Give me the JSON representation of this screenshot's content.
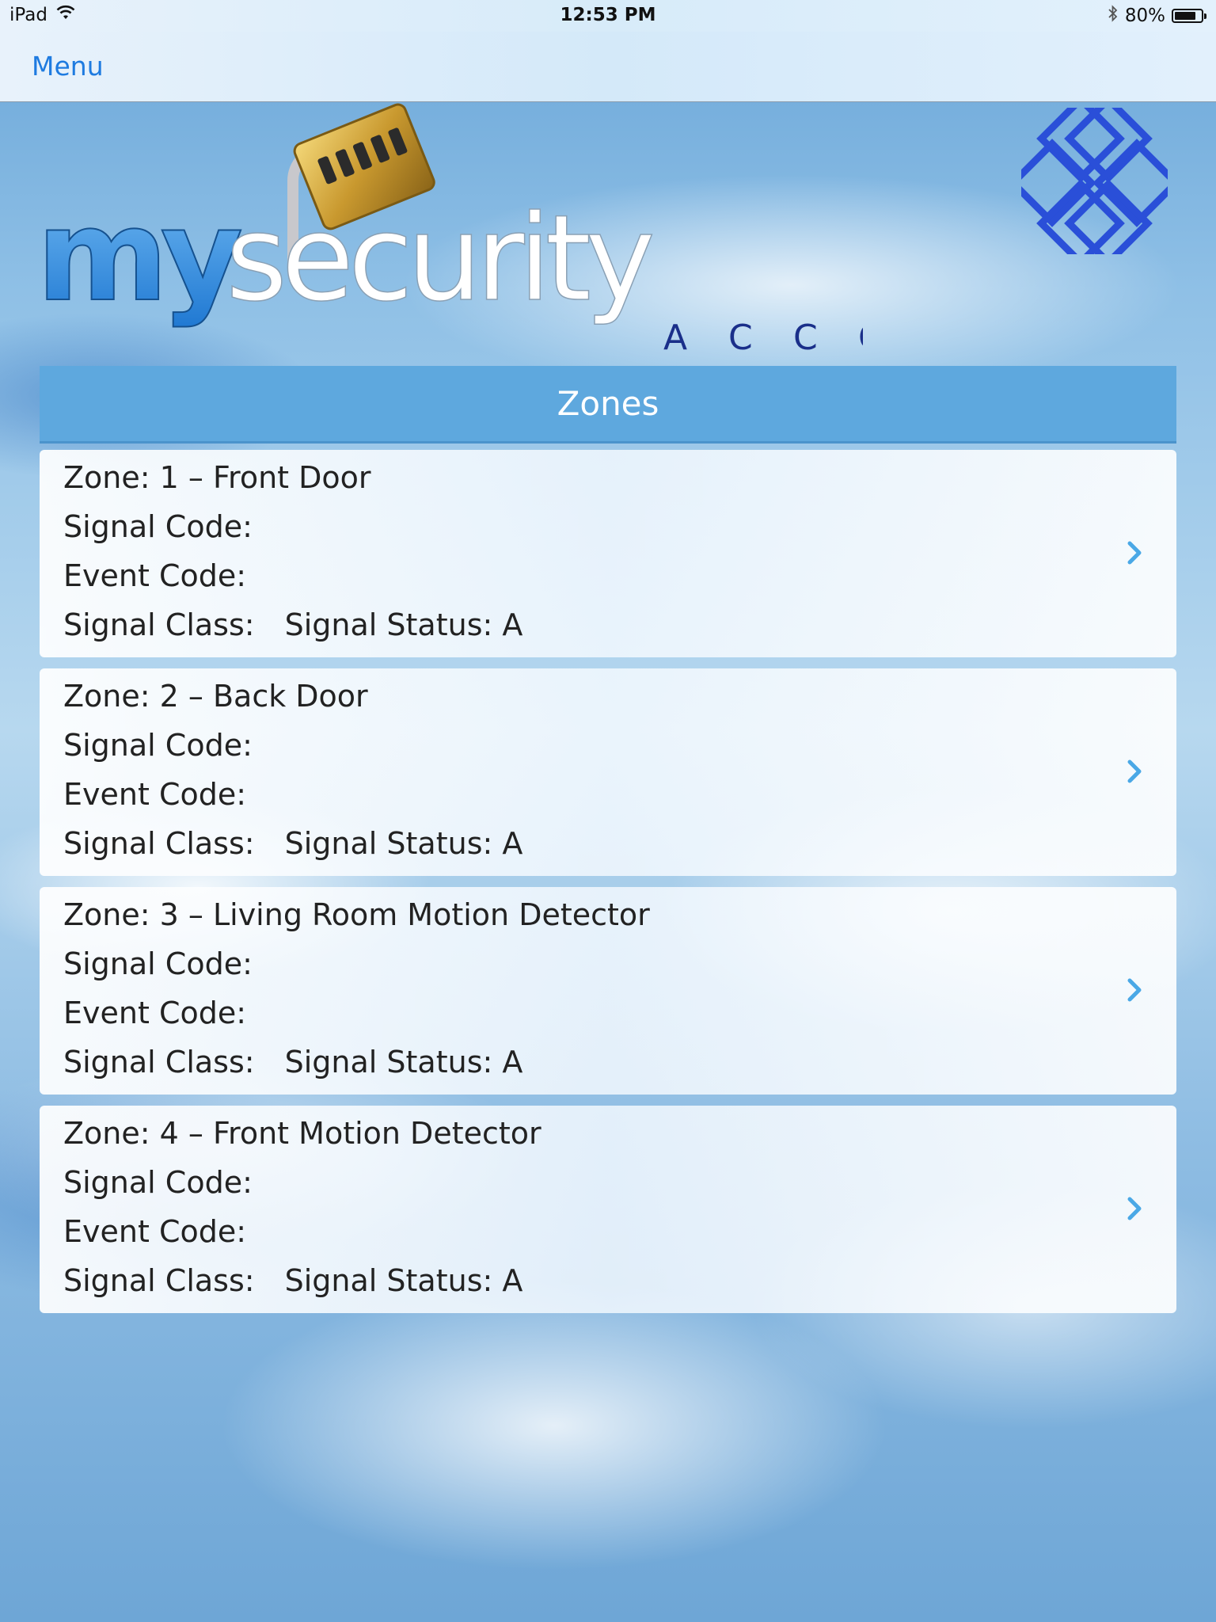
{
  "status_bar": {
    "device": "iPad",
    "time": "12:53 PM",
    "battery_text": "80%",
    "battery_level": 0.8,
    "icons": [
      "wifi-icon",
      "bluetooth-icon",
      "battery-icon"
    ]
  },
  "nav": {
    "menu_label": "Menu"
  },
  "logo": {
    "word_my": "my",
    "word_security": "security",
    "word_account": "A C C O U N T"
  },
  "zones": {
    "title": "Zones",
    "items": [
      {
        "zone": "Zone: 1 – Front Door",
        "signal_code": "Signal Code:",
        "event_code": "Event Code:",
        "signal_class": "Signal Class:",
        "signal_status": "Signal Status: A"
      },
      {
        "zone": "Zone: 2 – Back Door",
        "signal_code": "Signal Code:",
        "event_code": "Event Code:",
        "signal_class": "Signal Class:",
        "signal_status": "Signal Status: A"
      },
      {
        "zone": "Zone: 3 – Living Room Motion Detector",
        "signal_code": "Signal Code:",
        "event_code": "Event Code:",
        "signal_class": "Signal Class:",
        "signal_status": "Signal Status: A"
      },
      {
        "zone": "Zone: 4 – Front Motion Detector",
        "signal_code": "Signal Code:",
        "event_code": "Event Code:",
        "signal_class": "Signal Class:",
        "signal_status": "Signal Status: A"
      }
    ]
  },
  "colors": {
    "accent": "#1e7be0",
    "header_bar": "#5ea8de",
    "chevron": "#4aa8e6",
    "logo_blue": "#2f8fe0",
    "emblem_blue": "#2a4fd8"
  }
}
